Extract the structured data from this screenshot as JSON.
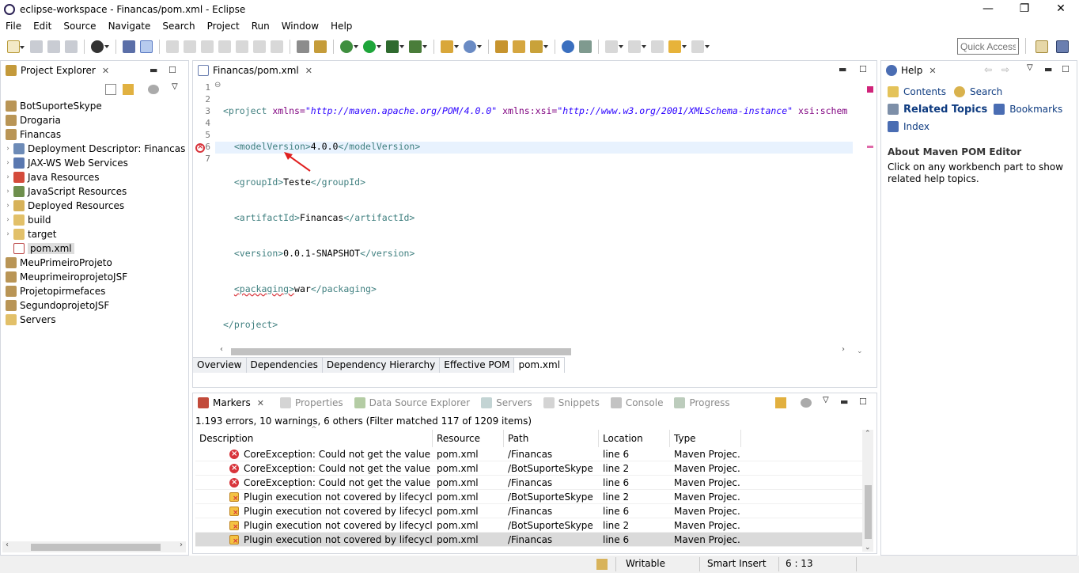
{
  "window": {
    "title": "eclipse-workspace - Financas/pom.xml - Eclipse",
    "controls": {
      "minimize": "—",
      "restore": "❐",
      "close": "✕"
    }
  },
  "menu": [
    "File",
    "Edit",
    "Source",
    "Navigate",
    "Search",
    "Project",
    "Run",
    "Window",
    "Help"
  ],
  "toolbar": {
    "quick_access_placeholder": "Quick Access"
  },
  "colors": {
    "accent": "#2c5ca8",
    "error": "#d8343b",
    "warning": "#f4c242",
    "tag": "#3f7f7f",
    "attr": "#7f007f",
    "string": "#2a00ff"
  },
  "project_explorer": {
    "title": "Project Explorer",
    "items": [
      {
        "label": "BotSuporteSkype",
        "icon": "project-icon",
        "depth": 0,
        "expanded": false
      },
      {
        "label": "Drogaria",
        "icon": "project-icon",
        "depth": 0,
        "expanded": false
      },
      {
        "label": "Financas",
        "icon": "project-icon",
        "depth": 0,
        "expanded": true
      },
      {
        "label": "Deployment Descriptor: Financas",
        "icon": "deployment-descriptor-icon",
        "depth": 1,
        "expanded": false
      },
      {
        "label": "JAX-WS Web Services",
        "icon": "web-services-icon",
        "depth": 1,
        "expanded": false
      },
      {
        "label": "Java Resources",
        "icon": "java-resources-icon",
        "depth": 1,
        "expanded": false
      },
      {
        "label": "JavaScript Resources",
        "icon": "javascript-resources-icon",
        "depth": 1,
        "expanded": false
      },
      {
        "label": "Deployed Resources",
        "icon": "deployed-resources-icon",
        "depth": 1,
        "expanded": false
      },
      {
        "label": "build",
        "icon": "folder-icon",
        "depth": 1,
        "expanded": false
      },
      {
        "label": "target",
        "icon": "folder-icon",
        "depth": 1,
        "expanded": false
      },
      {
        "label": "pom.xml",
        "icon": "xml-file-icon",
        "depth": 1,
        "selected": true
      },
      {
        "label": "MeuPrimeiroProjeto",
        "icon": "project-icon",
        "depth": 0
      },
      {
        "label": "MeuprimeiroprojetoJSF",
        "icon": "project-icon",
        "depth": 0
      },
      {
        "label": "Projetopirmefaces",
        "icon": "project-icon",
        "depth": 0
      },
      {
        "label": "SegundoprojetoJSF",
        "icon": "project-icon",
        "depth": 0
      },
      {
        "label": "Servers",
        "icon": "folder-icon",
        "depth": 0
      }
    ]
  },
  "editor": {
    "tab_title": "Financas/pom.xml",
    "lines": [
      {
        "num": "1",
        "fold": "⊖"
      },
      {
        "num": "2"
      },
      {
        "num": "3"
      },
      {
        "num": "4"
      },
      {
        "num": "5"
      },
      {
        "num": "6",
        "error": true
      },
      {
        "num": "7"
      }
    ],
    "code": {
      "l1_open": "<project ",
      "l1_attr1": "xmlns=",
      "l1_val1": "\"http://maven.apache.org/POM/4.0.0\"",
      "l1_attr2": " xmlns:xsi=",
      "l1_val2": "\"http://www.w3.org/2001/XMLSchema-instance\"",
      "l1_attr3": " xsi:schem",
      "l2_open": "<modelVersion>",
      "l2_text": "4.0.0",
      "l2_close": "</modelVersion>",
      "l3_open": "<groupId>",
      "l3_text": "Teste",
      "l3_close": "</groupId>",
      "l4_open": "<artifactId>",
      "l4_text": "Financas",
      "l4_close": "</artifactId>",
      "l5_open": "<version>",
      "l5_text": "0.0.1-SNAPSHOT",
      "l5_close": "</version>",
      "l6_open": "<packaging>",
      "l6_text": "war",
      "l6_close": "</packaging>",
      "l7_close": "</project>"
    },
    "bottom_tabs": [
      "Overview",
      "Dependencies",
      "Dependency Hierarchy",
      "Effective POM",
      "pom.xml"
    ],
    "active_bottom_tab": "pom.xml"
  },
  "bottom_panel": {
    "tabs": [
      {
        "label": "Markers",
        "icon": "markers-icon",
        "active": true
      },
      {
        "label": "Properties",
        "icon": "properties-icon"
      },
      {
        "label": "Data Source Explorer",
        "icon": "data-source-icon"
      },
      {
        "label": "Servers",
        "icon": "servers-icon"
      },
      {
        "label": "Snippets",
        "icon": "snippets-icon"
      },
      {
        "label": "Console",
        "icon": "console-icon"
      },
      {
        "label": "Progress",
        "icon": "progress-icon"
      }
    ],
    "summary": "1.193 errors, 10 warnings, 6 others (Filter matched 117 of 1209 items)",
    "columns": [
      "Description",
      "Resource",
      "Path",
      "Location",
      "Type"
    ],
    "rows": [
      {
        "severity": "error",
        "description": "CoreException: Could not get the value for pa",
        "resource": "pom.xml",
        "path": "/Financas",
        "location": "line 6",
        "type": "Maven Projec..."
      },
      {
        "severity": "error",
        "description": "CoreException: Could not get the value for pa",
        "resource": "pom.xml",
        "path": "/BotSuporteSkype",
        "location": "line 2",
        "type": "Maven Projec..."
      },
      {
        "severity": "error",
        "description": "CoreException: Could not get the value for pa",
        "resource": "pom.xml",
        "path": "/Financas",
        "location": "line 6",
        "type": "Maven Projec..."
      },
      {
        "severity": "warning",
        "description": "Plugin execution not covered by lifecycle cor",
        "resource": "pom.xml",
        "path": "/BotSuporteSkype",
        "location": "line 2",
        "type": "Maven Projec..."
      },
      {
        "severity": "warning",
        "description": "Plugin execution not covered by lifecycle cor",
        "resource": "pom.xml",
        "path": "/Financas",
        "location": "line 6",
        "type": "Maven Projec..."
      },
      {
        "severity": "warning",
        "description": "Plugin execution not covered by lifecycle cor",
        "resource": "pom.xml",
        "path": "/BotSuporteSkype",
        "location": "line 2",
        "type": "Maven Projec..."
      },
      {
        "severity": "warning",
        "description": "Plugin execution not covered by lifecycle cor",
        "resource": "pom.xml",
        "path": "/Financas",
        "location": "line 6",
        "type": "Maven Projec...",
        "selected": true
      }
    ]
  },
  "help": {
    "title": "Help",
    "links": [
      {
        "label": "Contents",
        "icon": "contents-icon"
      },
      {
        "label": "Search",
        "icon": "search-icon"
      },
      {
        "label": "Related Topics",
        "icon": "related-topics-icon",
        "bold": true
      },
      {
        "label": "Bookmarks",
        "icon": "bookmarks-icon"
      },
      {
        "label": "Index",
        "icon": "index-icon"
      }
    ],
    "about_title": "About Maven POM Editor",
    "about_text": "Click on any workbench part to show related help topics."
  },
  "status": {
    "mode": "Writable",
    "insert": "Smart Insert",
    "position": "6 : 13"
  }
}
